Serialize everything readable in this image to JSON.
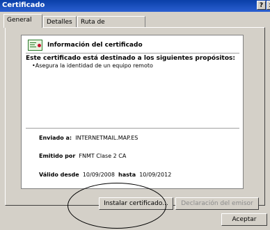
{
  "window": {
    "title": "Certificado",
    "help_label": "?",
    "close_label": "x"
  },
  "tabs": [
    {
      "label": "General"
    },
    {
      "label": "Detalles"
    },
    {
      "label": "Ruta de certificación"
    }
  ],
  "info": {
    "heading": "Información del certificado",
    "purposes_title": "Este certificado está destinado a los siguientes propósitos:",
    "purposes": [
      "•Asegura la identidad de un equipo remoto"
    ],
    "issued_to_label": "Enviado a:",
    "issued_to_value": "INTERNETMAIL.MAP.ES",
    "issued_by_label": "Emitido por",
    "issued_by_value": "FNMT Clase 2 CA",
    "valid_from_label": "Válido desde",
    "valid_from_value": "10/09/2008",
    "valid_to_label": "hasta",
    "valid_to_value": "10/09/2012"
  },
  "buttons": {
    "install": "Instalar certificado...",
    "issuer_statement": "Declaración del emisor",
    "ok": "Aceptar"
  }
}
